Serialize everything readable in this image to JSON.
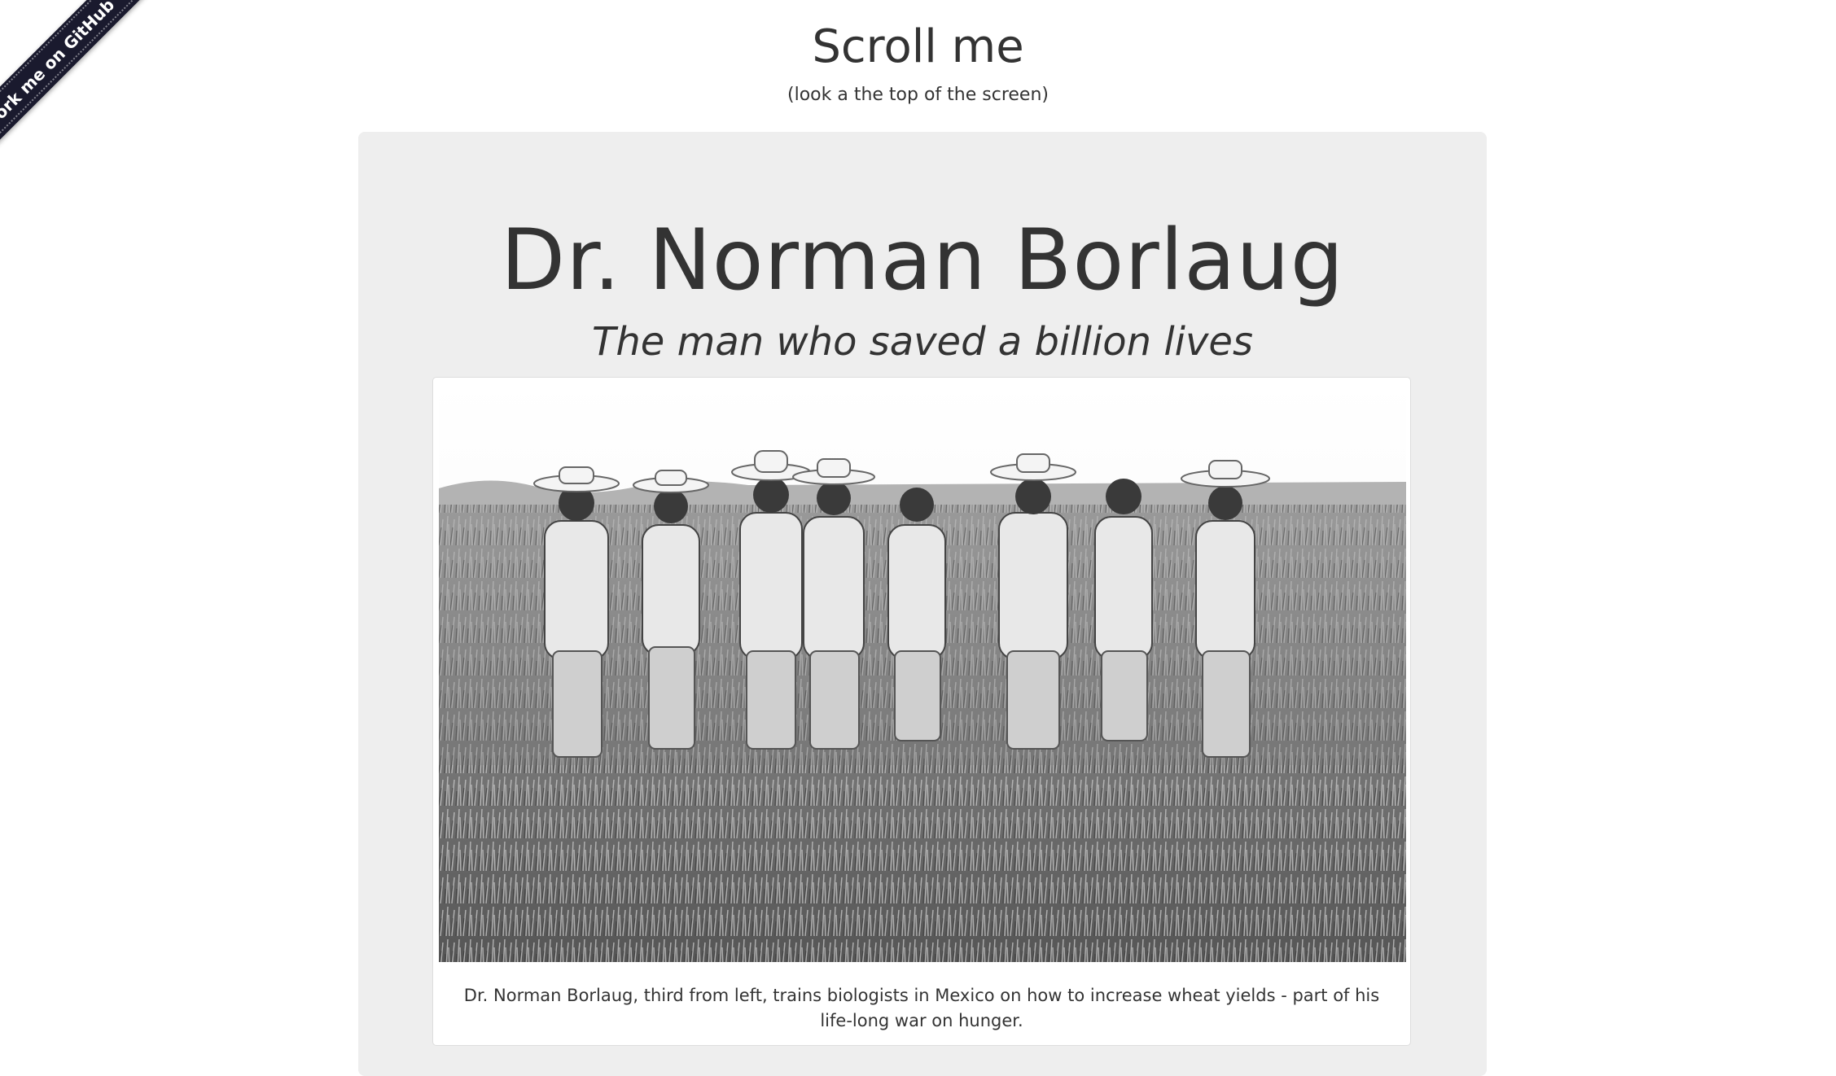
{
  "ribbon": {
    "label": "Fork me on GitHub"
  },
  "header": {
    "title": "Scroll me",
    "subtitle": "(look a the top of the screen)"
  },
  "hero": {
    "title": "Dr. Norman Borlaug",
    "tagline": "The man who saved a billion lives"
  },
  "figure": {
    "image_icon": "photo-icon",
    "caption": "Dr. Norman Borlaug, third from left, trains biologists in Mexico on how to increase wheat yields - part of his life-long war on hunger."
  },
  "colors": {
    "background": "#ffffff",
    "panel": "#eeeeee",
    "text": "#333333",
    "ribbon": "#1a1a2e"
  }
}
